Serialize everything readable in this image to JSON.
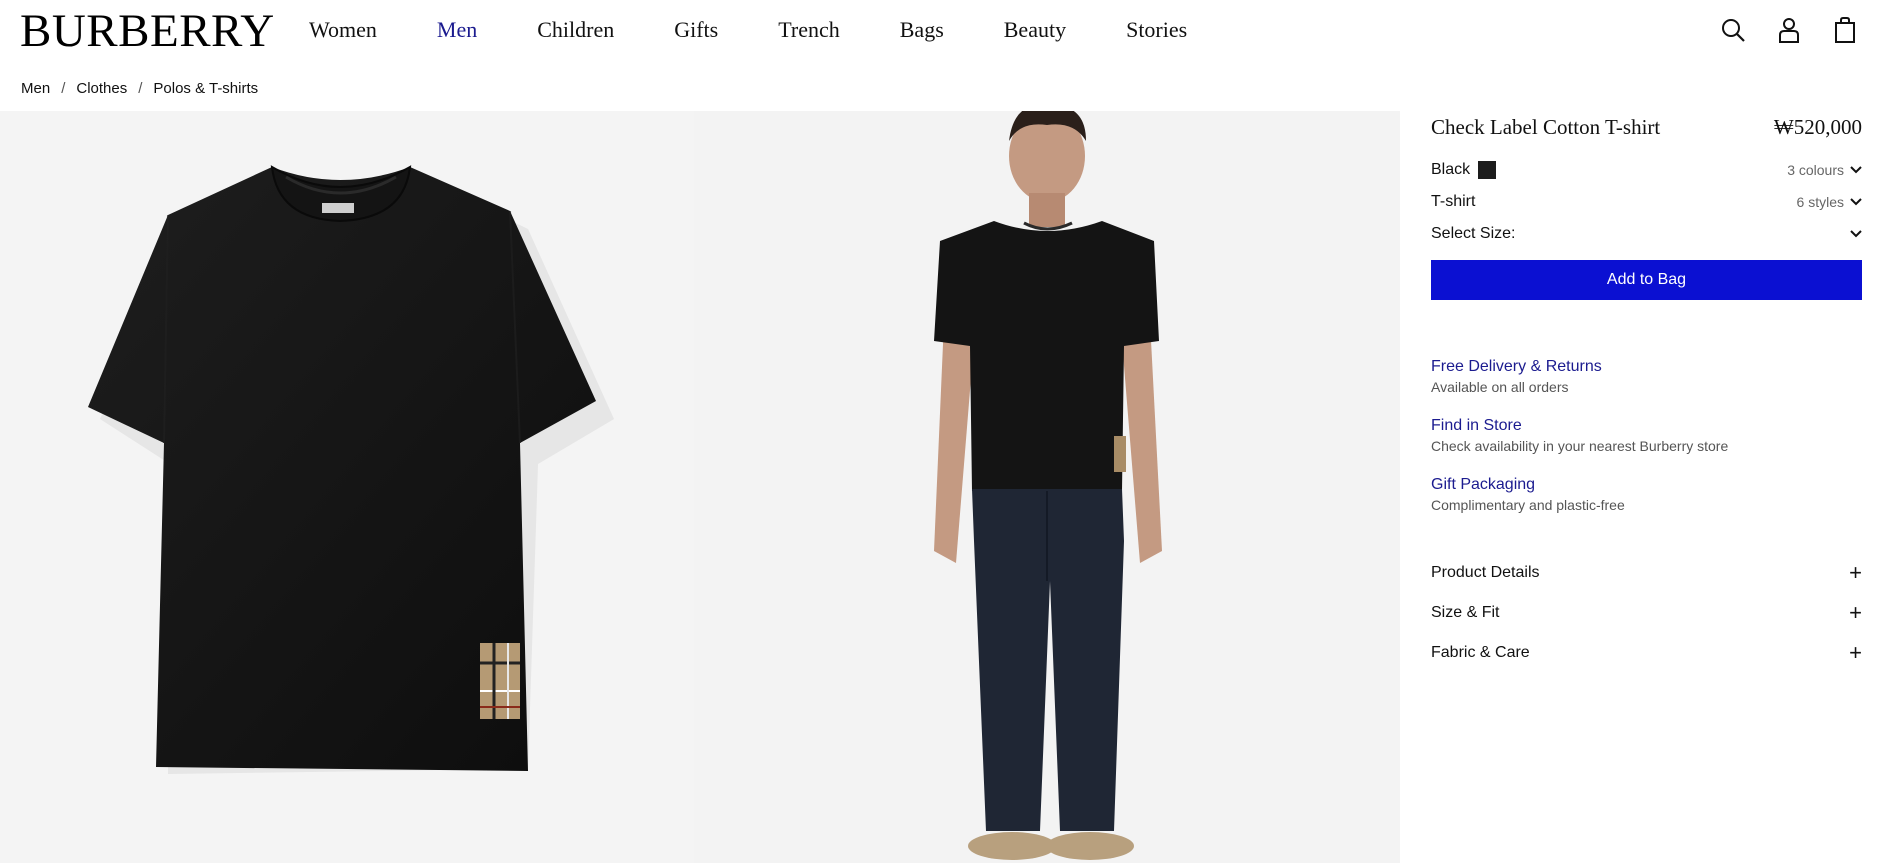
{
  "brand": {
    "logo": "BURBERRY"
  },
  "nav": {
    "items": [
      {
        "label": "Women"
      },
      {
        "label": "Men"
      },
      {
        "label": "Children"
      },
      {
        "label": "Gifts"
      },
      {
        "label": "Trench"
      },
      {
        "label": "Bags"
      },
      {
        "label": "Beauty"
      },
      {
        "label": "Stories"
      }
    ],
    "active": "Men"
  },
  "header_icons": [
    "search-icon",
    "account-icon",
    "bag-icon"
  ],
  "breadcrumb": [
    "Men",
    "Clothes",
    "Polos & T-shirts"
  ],
  "breadcrumb_separator": "/",
  "product": {
    "title": "Check Label Cotton T-shirt",
    "price": "₩520,000",
    "colour": {
      "label": "Black",
      "swatch": "#1c1c1c",
      "count": "3 colours"
    },
    "style": {
      "label": "T-shirt",
      "count": "6 styles"
    },
    "size": {
      "label": "Select Size:"
    },
    "add_to_bag": "Add to Bag"
  },
  "services": [
    {
      "title": "Free Delivery & Returns",
      "subtitle": "Available on all orders"
    },
    {
      "title": "Find in Store",
      "subtitle": "Check availability in your nearest Burberry store"
    },
    {
      "title": "Gift Packaging",
      "subtitle": "Complimentary and plastic-free"
    }
  ],
  "accordion": [
    {
      "label": "Product Details"
    },
    {
      "label": "Size & Fit"
    },
    {
      "label": "Fabric & Care"
    }
  ],
  "colors": {
    "accent": "#0b10d2",
    "link": "#1b1b8f"
  }
}
